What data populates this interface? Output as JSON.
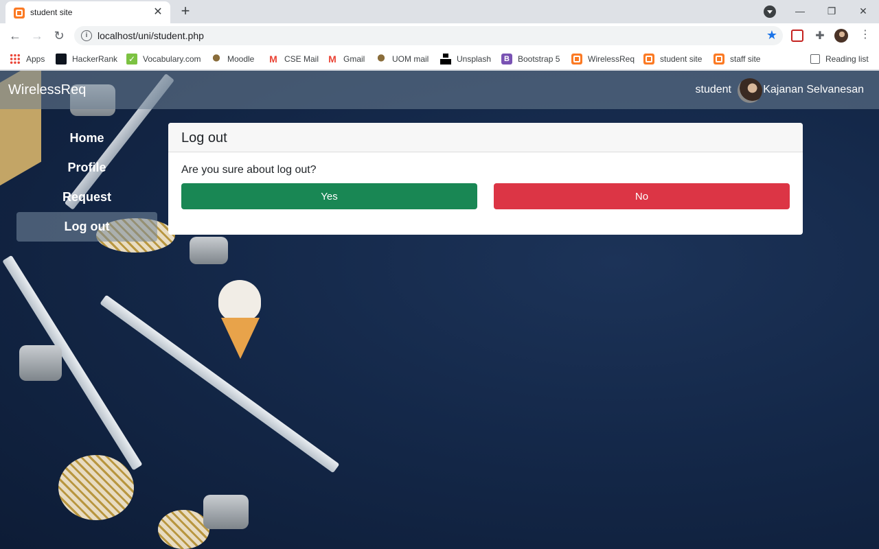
{
  "browser": {
    "tab_title": "student site",
    "url": "localhost/uni/student.php",
    "bookmarks": [
      "Apps",
      "HackerRank",
      "Vocabulary.com",
      "Moodle",
      "CSE Mail",
      "Gmail",
      "UOM mail",
      "Unsplash",
      "Bootstrap 5",
      "WirelessReq",
      "student site",
      "staff site"
    ],
    "reading_list": "Reading list"
  },
  "navbar": {
    "brand": "WirelessReq",
    "role": "student",
    "username": "Kajanan Selvanesan"
  },
  "sidebar": {
    "items": [
      {
        "label": "Home"
      },
      {
        "label": "Profile"
      },
      {
        "label": "Request"
      },
      {
        "label": "Log out",
        "active": true
      }
    ]
  },
  "dialog": {
    "title": "Log out",
    "question": "Are you sure about log out?",
    "yes_label": "Yes",
    "no_label": "No"
  },
  "colors": {
    "yes": "#198754",
    "no": "#dc3545",
    "background": "#142849"
  }
}
